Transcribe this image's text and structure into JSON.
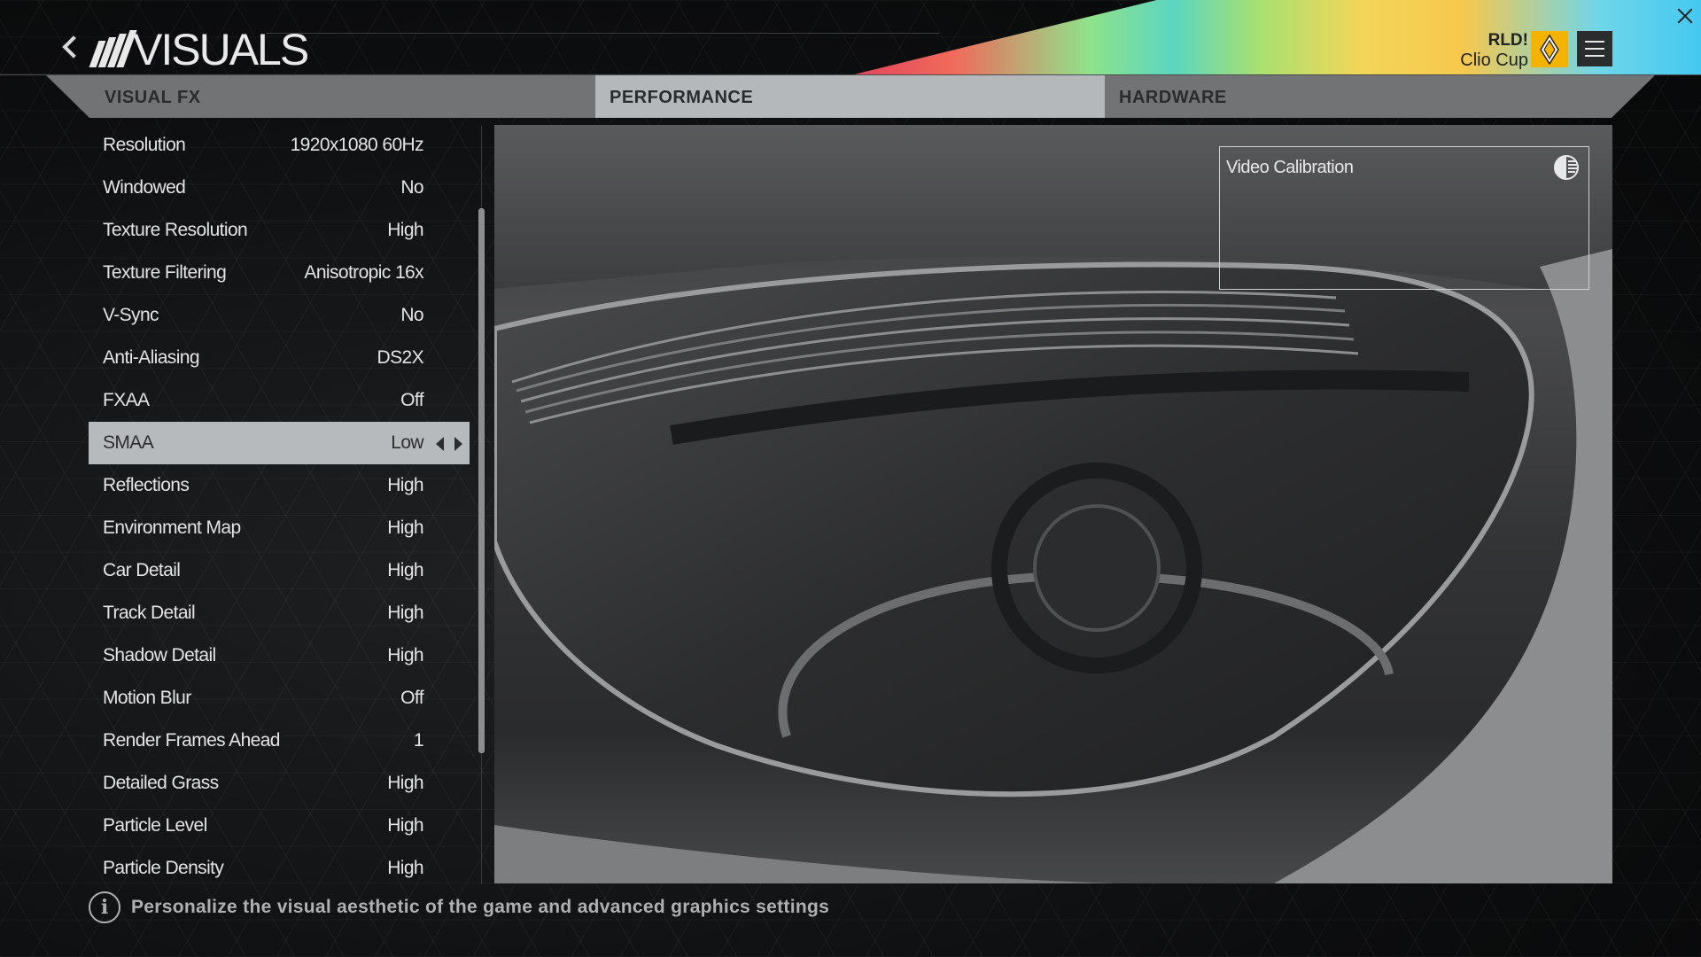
{
  "header": {
    "title": "VISUALS",
    "car_pretitle": "RLD!",
    "car_name": "Clio Cup",
    "brand_badge_text": "RENAULT"
  },
  "tabs": [
    {
      "label": "VISUAL FX",
      "active": false
    },
    {
      "label": "PERFORMANCE",
      "active": true
    },
    {
      "label": "HARDWARE",
      "active": false
    }
  ],
  "settings": [
    {
      "label": "Resolution",
      "value": "1920x1080 60Hz"
    },
    {
      "label": "Windowed",
      "value": "No"
    },
    {
      "label": "Texture Resolution",
      "value": "High"
    },
    {
      "label": "Texture Filtering",
      "value": "Anisotropic 16x"
    },
    {
      "label": "V-Sync",
      "value": "No"
    },
    {
      "label": "Anti-Aliasing",
      "value": "DS2X"
    },
    {
      "label": "FXAA",
      "value": "Off"
    },
    {
      "label": "SMAA",
      "value": "Low",
      "selected": true
    },
    {
      "label": "Reflections",
      "value": "High"
    },
    {
      "label": "Environment Map",
      "value": "High"
    },
    {
      "label": "Car Detail",
      "value": "High"
    },
    {
      "label": "Track Detail",
      "value": "High"
    },
    {
      "label": "Shadow Detail",
      "value": "High"
    },
    {
      "label": "Motion Blur",
      "value": "Off"
    },
    {
      "label": "Render Frames Ahead",
      "value": "1"
    },
    {
      "label": "Detailed Grass",
      "value": "High"
    },
    {
      "label": "Particle Level",
      "value": "High"
    },
    {
      "label": "Particle Density",
      "value": "High"
    }
  ],
  "preview": {
    "calibration_label": "Video Calibration"
  },
  "footer": {
    "info_text": "Personalize the visual aesthetic of the game and advanced graphics settings"
  },
  "colors": {
    "badge": "#f4b300",
    "selected_row": "#b7babc",
    "tab_bar": "#717375"
  }
}
